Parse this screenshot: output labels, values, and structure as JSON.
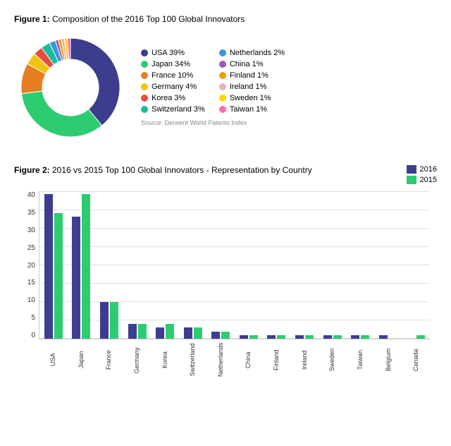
{
  "figure1": {
    "title": "Figure 1:",
    "title_rest": " Composition of the 2016 Top 100 Global Innovators",
    "source": "Source: Derwent World Patents Index",
    "legend": [
      {
        "label": "USA 39%",
        "color": "#3d3d8f"
      },
      {
        "label": "Japan 34%",
        "color": "#2ecc71"
      },
      {
        "label": "France 10%",
        "color": "#e67e22"
      },
      {
        "label": "Germany 4%",
        "color": "#f1c40f"
      },
      {
        "label": "Korea 3%",
        "color": "#e74c3c"
      },
      {
        "label": "Switzerland 3%",
        "color": "#1abc9c"
      },
      {
        "label": "Netherlands 2%",
        "color": "#3498db"
      },
      {
        "label": "China 1%",
        "color": "#9b59b6"
      },
      {
        "label": "Finland 1%",
        "color": "#f39c12"
      },
      {
        "label": "Ireland 1%",
        "color": "#e8b4b8"
      },
      {
        "label": "Sweden 1%",
        "color": "#ffd700"
      },
      {
        "label": "Taiwan 1%",
        "color": "#ff69b4"
      }
    ],
    "donut": {
      "segments": [
        {
          "pct": 39,
          "color": "#3d3d8f"
        },
        {
          "pct": 34,
          "color": "#2ecc71"
        },
        {
          "pct": 10,
          "color": "#e67e22"
        },
        {
          "pct": 4,
          "color": "#f1c40f"
        },
        {
          "pct": 3,
          "color": "#e74c3c"
        },
        {
          "pct": 3,
          "color": "#1abc9c"
        },
        {
          "pct": 2,
          "color": "#3498db"
        },
        {
          "pct": 1,
          "color": "#9b59b6"
        },
        {
          "pct": 1,
          "color": "#f39c12"
        },
        {
          "pct": 1,
          "color": "#e8b4b8"
        },
        {
          "pct": 1,
          "color": "#ffd700"
        },
        {
          "pct": 1,
          "color": "#ff69b4"
        }
      ]
    }
  },
  "figure2": {
    "title": "Figure 2:",
    "title_rest": " 2016 vs 2015 Top 100 Global Innovators - Representation by Country",
    "legend": [
      {
        "label": "2016",
        "color": "#3d3d8f"
      },
      {
        "label": "2015",
        "color": "#2ecc71"
      }
    ],
    "y_labels": [
      "0",
      "5",
      "10",
      "15",
      "20",
      "25",
      "30",
      "35",
      "40"
    ],
    "max_value": 40,
    "countries": [
      {
        "name": "USA",
        "v2016": 39,
        "v2015": 34
      },
      {
        "name": "Japan",
        "v2016": 33,
        "v2015": 39
      },
      {
        "name": "France",
        "v2016": 10,
        "v2015": 10
      },
      {
        "name": "Germany",
        "v2016": 4,
        "v2015": 4
      },
      {
        "name": "Korea",
        "v2016": 3,
        "v2015": 4
      },
      {
        "name": "Switzerland",
        "v2016": 3,
        "v2015": 3
      },
      {
        "name": "Netherlands",
        "v2016": 2,
        "v2015": 2
      },
      {
        "name": "China",
        "v2016": 1,
        "v2015": 1
      },
      {
        "name": "Finland",
        "v2016": 1,
        "v2015": 1
      },
      {
        "name": "Ireland",
        "v2016": 1,
        "v2015": 1
      },
      {
        "name": "Sweden",
        "v2016": 1,
        "v2015": 1
      },
      {
        "name": "Taiwan",
        "v2016": 1,
        "v2015": 1
      },
      {
        "name": "Belgium",
        "v2016": 1,
        "v2015": 0
      },
      {
        "name": "Canada",
        "v2016": 0,
        "v2015": 1
      }
    ]
  }
}
